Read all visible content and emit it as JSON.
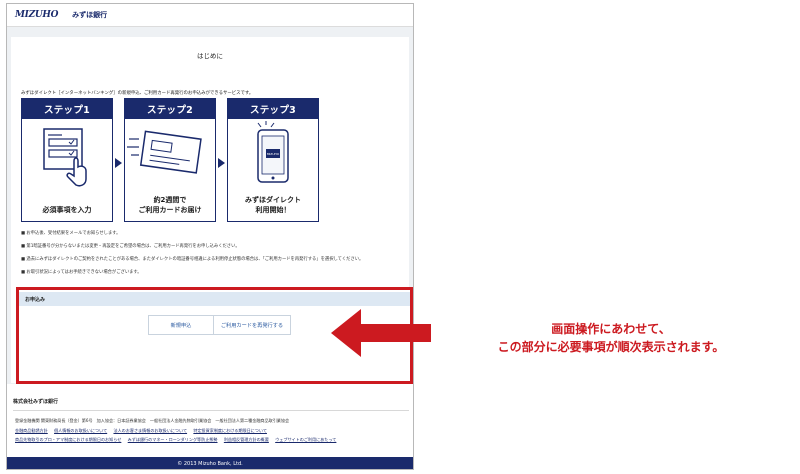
{
  "header": {
    "logo_en": "MIZUHO",
    "logo_jp": "みずほ銀行"
  },
  "page_title": "はじめに",
  "intro": "みずほダイレクト［インターネットバンキング］の新規申込、ご利用カード再発行のお申込みができるサービスです。",
  "steps": [
    {
      "label": "ステップ1",
      "caption": "必須事項を入力"
    },
    {
      "label": "ステップ2",
      "caption": "約2週間で\nご利用カードお届け"
    },
    {
      "label": "ステップ3",
      "caption": "みずほダイレクト\n利用開始！"
    }
  ],
  "phone_label": "MIZUHO",
  "notes": [
    "■ お申込後、受付結果をメールでお知らせします。",
    "■ 第1暗証番号が分からないまたは変更・再設定をご希望の場合は、ご利用カード再発行をお申し込みください。",
    "■ 過去にみずほダイレクトのご契約をされたことがある場合、またダイレクトの暗証番号相違による利用停止状態の場合は、「ご利用カードを再発行する」を選択してください。",
    "■ お取引状況によってはお手続きできない場合がございます。"
  ],
  "apply": {
    "heading": "お申込み",
    "new_button": "新規申込",
    "reissue_button": "ご利用カードを再発行する"
  },
  "footer": {
    "company": "株式会社みずほ銀行",
    "registration": "登録金融機関 関東財務局長（登金）第6号　加入協会：日本証券業協会　一般社団法人金融先物取引業協会　一般社団法人第二種金融商品取引業協会",
    "links_row1": [
      "金融商品勧誘方針",
      "個人情報のお取扱いについて",
      "法人のお客さま情報のお取扱いについて",
      "特定投資家制度における期限日について"
    ],
    "links_row2": [
      "商品先物取引のプロ・アマ制度における期限日のお知らせ",
      "みずほ銀行のマネー・ローンダリング等防止態勢",
      "利益相反管理方針の概要",
      "ウェブサイトのご利用にあたって"
    ],
    "copyright": "© 2013 Mizuho Bank, Ltd."
  },
  "callout": {
    "line1": "画面操作にあわせて、",
    "line2": "この部分に必要事項が順次表示されます。"
  },
  "colors": {
    "brand_navy": "#1a2a6c",
    "highlight_red": "#cc1a20",
    "apply_bar": "#dde8f3"
  }
}
